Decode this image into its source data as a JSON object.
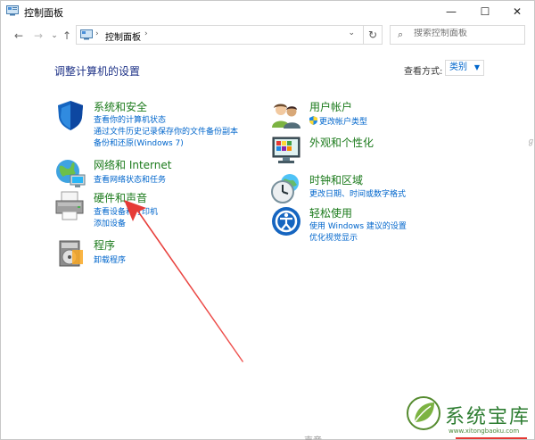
{
  "window": {
    "title": "控制面板",
    "controls": {
      "minimize": "—",
      "maximize": "☐",
      "close": "✕"
    }
  },
  "nav": {
    "back": "←",
    "forward": "→",
    "dropdown": "⌄",
    "up": "↑",
    "breadcrumb": "控制面板",
    "refresh": "↻",
    "search_placeholder": "搜索控制面板"
  },
  "main": {
    "heading": "调整计算机的设置",
    "view_by_label": "查看方式:",
    "view_by_value": "类别"
  },
  "left_categories": [
    {
      "title": "系统和安全",
      "icon": "shield-icon",
      "links": [
        "查看你的计算机状态",
        "通过文件历史记录保存你的文件备份副本",
        "备份和还原(Windows 7)"
      ]
    },
    {
      "title": "网络和 Internet",
      "icon": "network-globe-icon",
      "links": [
        "查看网络状态和任务"
      ]
    },
    {
      "title": "硬件和声音",
      "icon": "printer-icon",
      "links": [
        "查看设备和打印机",
        "添加设备"
      ]
    },
    {
      "title": "程序",
      "icon": "programs-icon",
      "links": [
        "卸载程序"
      ]
    }
  ],
  "right_categories": [
    {
      "title": "用户帐户",
      "icon": "users-icon",
      "links": [
        "更改帐户类型"
      ]
    },
    {
      "title": "外观和个性化",
      "icon": "monitor-palette-icon",
      "links": []
    },
    {
      "title": "时钟和区域",
      "icon": "clock-globe-icon",
      "links": [
        "更改日期、时间或数字格式"
      ]
    },
    {
      "title": "轻松使用",
      "icon": "ease-of-access-icon",
      "links": [
        "使用 Windows 建议的设置",
        "优化视觉显示"
      ]
    }
  ],
  "watermark": {
    "name": "系统宝库",
    "url": "www.xitongbaoku.com"
  },
  "bottom_partial_text": "声音",
  "colors": {
    "heading": "#1e3287",
    "category_title": "#1b7a1b",
    "link": "#0066cc",
    "arrow": "#e53935"
  }
}
